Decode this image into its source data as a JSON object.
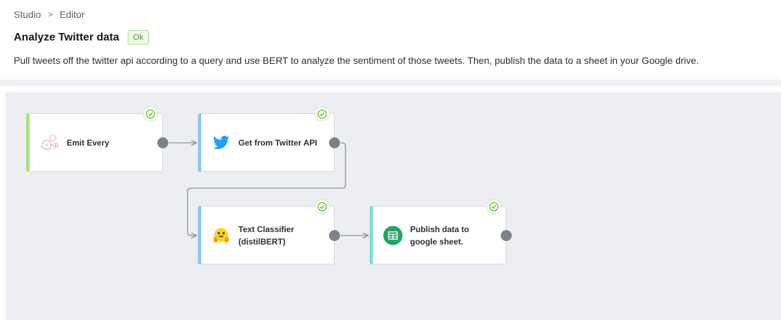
{
  "breadcrumb": {
    "root": "Studio",
    "separator": ">",
    "current": "Editor"
  },
  "header": {
    "title": "Analyze Twitter data",
    "status_badge": "Ok"
  },
  "description": "Pull tweets off the twitter api according to a query and use BERT to analyze the sentiment of those tweets. Then, publish the data to a sheet in your Google drive.",
  "nodes": [
    {
      "id": "emit",
      "label_line1": "Emit Every",
      "label_line2": "",
      "icon": "gears-icon",
      "accent": "#a8e07e",
      "status": "ok"
    },
    {
      "id": "twitter",
      "label_line1": "Get from Twitter API",
      "label_line2": "",
      "icon": "twitter-bird-icon",
      "accent": "#8ec8f2",
      "status": "ok"
    },
    {
      "id": "classifier",
      "label_line1": "Text Classifier",
      "label_line2": "(distilBERT)",
      "icon": "hugging-face-icon",
      "accent": "#8ec8f2",
      "status": "ok"
    },
    {
      "id": "sheets",
      "label_line1": "Publish data to",
      "label_line2": "google sheet.",
      "icon": "google-sheets-icon",
      "accent": "#7fe0d6",
      "status": "ok"
    }
  ],
  "colors": {
    "ok_green": "#52c41a",
    "port_gray": "#7d8289",
    "connector_gray": "#8a8f96"
  }
}
